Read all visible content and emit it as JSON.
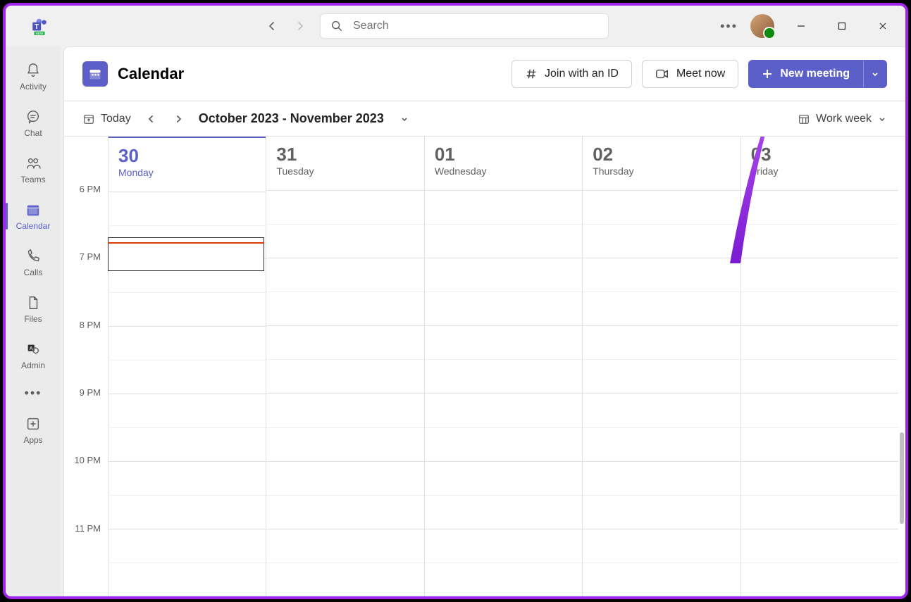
{
  "app": {
    "name": "Microsoft Teams"
  },
  "titlebar": {
    "search_placeholder": "Search"
  },
  "sidebar": {
    "items": [
      {
        "label": "Activity"
      },
      {
        "label": "Chat"
      },
      {
        "label": "Teams"
      },
      {
        "label": "Calendar"
      },
      {
        "label": "Calls"
      },
      {
        "label": "Files"
      },
      {
        "label": "Admin"
      }
    ],
    "apps_label": "Apps"
  },
  "header": {
    "title": "Calendar",
    "join_label": "Join with an ID",
    "meet_label": "Meet now",
    "new_label": "New meeting"
  },
  "toolbar": {
    "today_label": "Today",
    "range": "October 2023 - November 2023",
    "view_label": "Work week"
  },
  "calendar": {
    "days": [
      {
        "num": "30",
        "name": "Monday",
        "today": true
      },
      {
        "num": "31",
        "name": "Tuesday",
        "today": false
      },
      {
        "num": "01",
        "name": "Wednesday",
        "today": false
      },
      {
        "num": "02",
        "name": "Thursday",
        "today": false
      },
      {
        "num": "03",
        "name": "Friday",
        "today": false
      }
    ],
    "hours": [
      "6 PM",
      "7 PM",
      "8 PM",
      "9 PM",
      "10 PM",
      "11 PM"
    ]
  }
}
